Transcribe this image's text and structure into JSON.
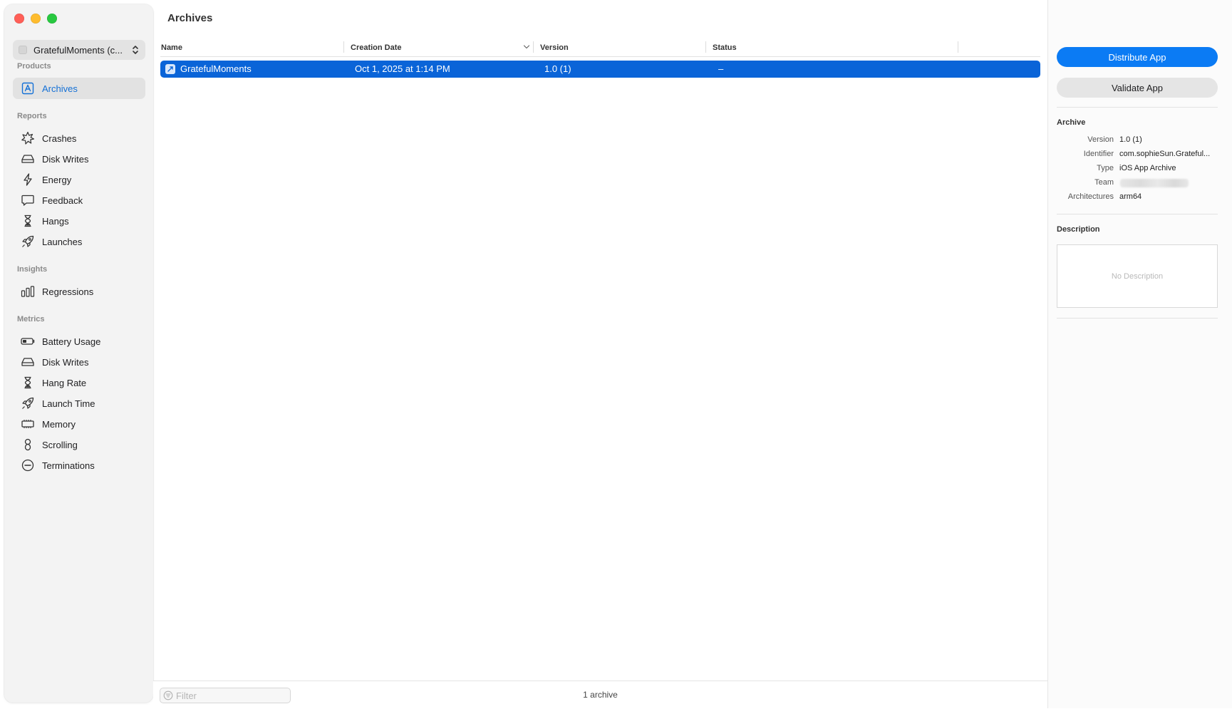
{
  "sidebar": {
    "product_picker": {
      "label": "GratefulMoments (c...",
      "icon": "app-icon"
    },
    "sections": {
      "products": "Products",
      "reports": "Reports",
      "insights": "Insights",
      "metrics": "Metrics"
    },
    "products": [
      {
        "label": "Archives",
        "icon": "archivebox-icon",
        "selected": true
      }
    ],
    "reports": [
      {
        "label": "Crashes",
        "icon": "crash-burst-icon"
      },
      {
        "label": "Disk Writes",
        "icon": "disk-drive-icon"
      },
      {
        "label": "Energy",
        "icon": "bolt-icon"
      },
      {
        "label": "Feedback",
        "icon": "speech-bubble-icon"
      },
      {
        "label": "Hangs",
        "icon": "hourglass-icon"
      },
      {
        "label": "Launches",
        "icon": "rocket-icon"
      }
    ],
    "insights": [
      {
        "label": "Regressions",
        "icon": "bar-chart-icon"
      }
    ],
    "metrics": [
      {
        "label": "Battery Usage",
        "icon": "battery-icon"
      },
      {
        "label": "Disk Writes",
        "icon": "disk-drive-icon"
      },
      {
        "label": "Hang Rate",
        "icon": "hourglass-icon"
      },
      {
        "label": "Launch Time",
        "icon": "rocket-icon"
      },
      {
        "label": "Memory",
        "icon": "memory-chip-icon"
      },
      {
        "label": "Scrolling",
        "icon": "scroll-icon"
      },
      {
        "label": "Terminations",
        "icon": "minus-circle-icon"
      }
    ]
  },
  "main": {
    "title": "Archives",
    "columns": [
      "Name",
      "Creation Date",
      "Version",
      "Status"
    ],
    "rows": [
      {
        "name": "GratefulMoments",
        "creation_date": "Oct 1, 2025 at 1:14 PM",
        "version": "1.0 (1)",
        "status": "–"
      }
    ],
    "filter_placeholder": "Filter",
    "archive_count": "1 archive"
  },
  "inspector": {
    "distribute_label": "Distribute App",
    "validate_label": "Validate App",
    "archive_heading": "Archive",
    "fields": {
      "version_key": "Version",
      "version_val": "1.0 (1)",
      "identifier_key": "Identifier",
      "identifier_val": "com.sophieSun.Grateful...",
      "type_key": "Type",
      "type_val": "iOS App Archive",
      "team_key": "Team",
      "arch_key": "Architectures",
      "arch_val": "arm64"
    },
    "description_heading": "Description",
    "description_placeholder": "No Description"
  },
  "colors": {
    "accent": "#0b7bf4",
    "selection": "#0a64d8",
    "close": "#ff5f57",
    "minimize": "#febc2e",
    "zoom": "#28c840"
  }
}
